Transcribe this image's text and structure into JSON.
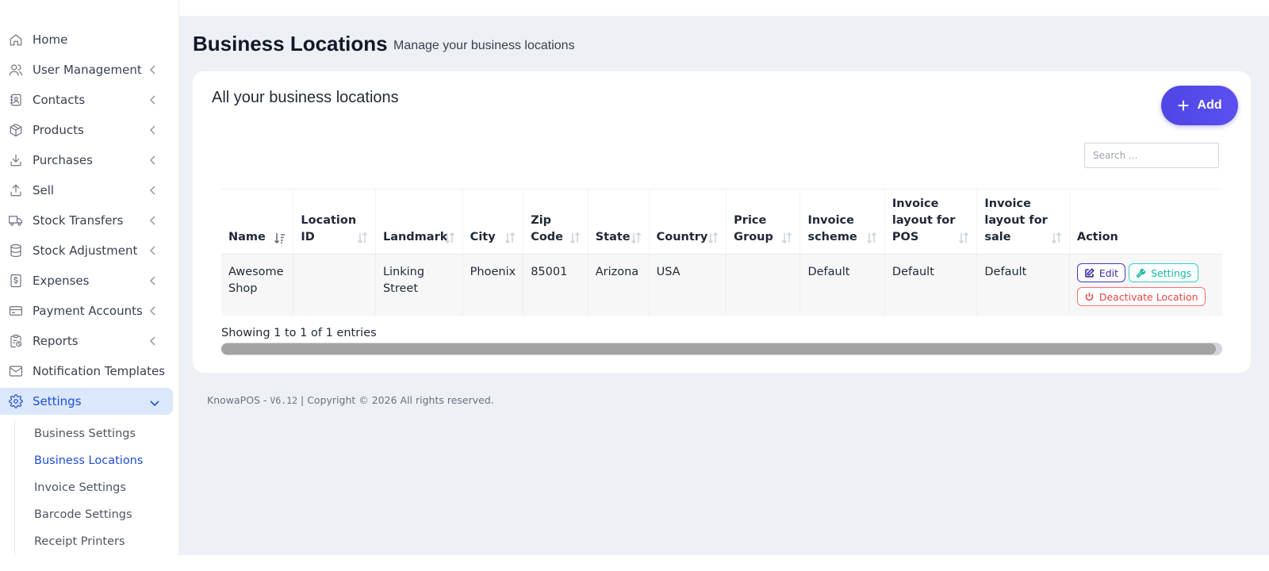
{
  "sidebar": {
    "items": [
      {
        "label": "Home"
      },
      {
        "label": "User Management"
      },
      {
        "label": "Contacts"
      },
      {
        "label": "Products"
      },
      {
        "label": "Purchases"
      },
      {
        "label": "Sell"
      },
      {
        "label": "Stock Transfers"
      },
      {
        "label": "Stock Adjustment"
      },
      {
        "label": "Expenses"
      },
      {
        "label": "Payment Accounts"
      },
      {
        "label": "Reports"
      },
      {
        "label": "Notification Templates"
      },
      {
        "label": "Settings"
      }
    ],
    "sub_items": [
      {
        "label": "Business Settings"
      },
      {
        "label": "Business Locations"
      },
      {
        "label": "Invoice Settings"
      },
      {
        "label": "Barcode Settings"
      },
      {
        "label": "Receipt Printers"
      }
    ]
  },
  "header": {
    "title": "Business Locations",
    "subtitle": "Manage your business locations"
  },
  "card": {
    "title": "All your business locations",
    "add_label": "Add",
    "search_placeholder": "Search ..."
  },
  "table": {
    "columns": [
      "Name",
      "Location ID",
      "Landmark",
      "City",
      "Zip Code",
      "State",
      "Country",
      "Price Group",
      "Invoice scheme",
      "Invoice layout for POS",
      "Invoice layout for sale",
      "Action"
    ],
    "rows": [
      {
        "name": "Awesome Shop",
        "location_id": "",
        "landmark": "Linking Street",
        "city": "Phoenix",
        "zip": "85001",
        "state": "Arizona",
        "country": "USA",
        "price_group": "",
        "invoice_scheme": "Default",
        "layout_pos": "Default",
        "layout_sale": "Default"
      }
    ],
    "actions": {
      "edit": "Edit",
      "settings": "Settings",
      "deactivate": "Deactivate Location"
    },
    "entries_text": "Showing 1 to 1 of 1 entries"
  },
  "footer": {
    "prefix": "KnowaPOS - ",
    "version": "V6.12",
    "suffix": " | Copyright © 2026 All rights reserved."
  },
  "colors": {
    "accent": "#1d4ed8",
    "add_button": "#4f46e5",
    "settings_button": "#14b8a6",
    "deactivate_button": "#ef4444"
  },
  "icons": [
    "home-icon",
    "users-icon",
    "contacts-icon",
    "box-icon",
    "download-icon",
    "upload-icon",
    "truck-icon",
    "database-icon",
    "dollar-doc-icon",
    "card-icon",
    "report-icon",
    "mail-icon",
    "gear-icon",
    "sort-icon",
    "edit-icon",
    "wrench-icon",
    "power-icon",
    "plus-icon",
    "chevron-left-icon",
    "chevron-down-icon"
  ]
}
